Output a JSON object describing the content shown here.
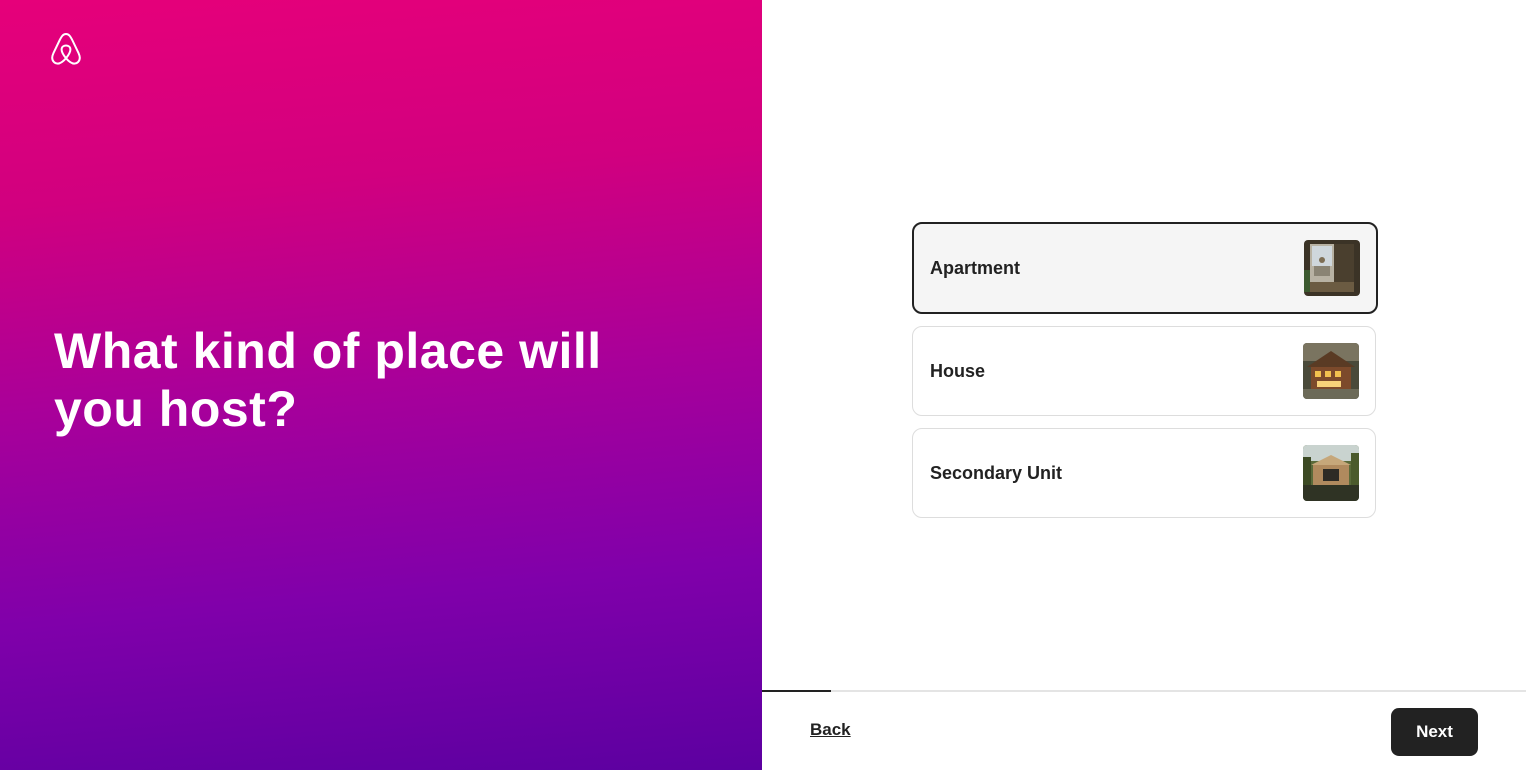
{
  "brand": {
    "logo_icon": "airbnb-logo-icon"
  },
  "headline": "What kind of place will you host?",
  "options": [
    {
      "label": "Apartment",
      "selected": true,
      "thumb_icon": "apartment-photo"
    },
    {
      "label": "House",
      "selected": false,
      "thumb_icon": "house-photo"
    },
    {
      "label": "Secondary Unit",
      "selected": false,
      "thumb_icon": "secondary-unit-photo"
    }
  ],
  "progress": {
    "fraction": 0.09
  },
  "footer": {
    "back_label": "Back",
    "next_label": "Next"
  },
  "colors": {
    "brand_pink": "#e6007a",
    "brand_purple": "#5c00a0",
    "dark": "#222222"
  }
}
